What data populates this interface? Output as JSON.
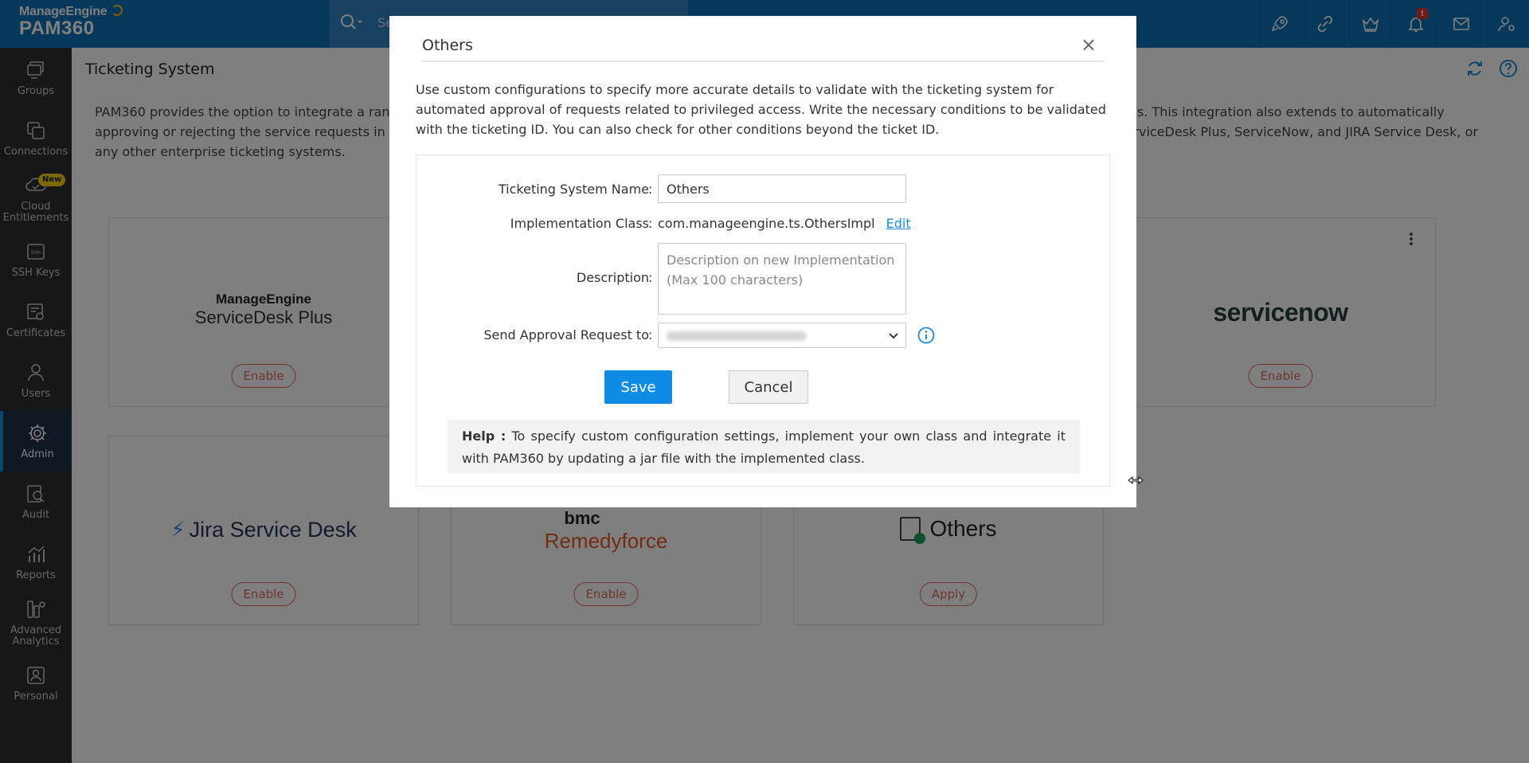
{
  "brand": {
    "company": "ManageEngine",
    "product": "PAM360"
  },
  "search": {
    "placeholder": "Se"
  },
  "notifications": {
    "badge": "!"
  },
  "sidebar": {
    "items": [
      {
        "label": "Groups"
      },
      {
        "label": "Connections"
      },
      {
        "label": "Cloud Entitlements",
        "badge": "New"
      },
      {
        "label": "SSH Keys"
      },
      {
        "label": "Certificates"
      },
      {
        "label": "Users"
      },
      {
        "label": "Admin"
      },
      {
        "label": "Audit"
      },
      {
        "label": "Reports"
      },
      {
        "label": "Advanced Analytics"
      },
      {
        "label": "Personal"
      }
    ]
  },
  "page": {
    "title": "Ticketing System",
    "intro": "PAM360 provides the option to integrate a range of ticketing systems to ensure that only the users with a valid ticket ID access the authorized privileged passwords. This integration also extends to automatically approving or rejecting the service requests in the ticketing system. From this page, you can select the ticketing system that you wish to integrate with, such as ServiceDesk Plus, ServiceNow, and JIRA Service Desk, or any other enterprise ticketing systems."
  },
  "cards": [
    {
      "name": "ManageEngine ServiceDesk Plus",
      "logo_top": "ManageEngine",
      "logo_bottom": "ServiceDesk Plus",
      "action": "Enable"
    },
    {
      "name": "ServiceNow",
      "logo": "servicenow",
      "action": "Enable"
    },
    {
      "name": "Jira Service Desk",
      "logo": "Jira Service Desk",
      "action": "Enable"
    },
    {
      "name": "BMC Remedyforce",
      "logo_top": "bmc",
      "logo_bottom": "Remedyforce",
      "action": "Enable"
    },
    {
      "name": "Others",
      "logo": "Others",
      "action": "Apply"
    }
  ],
  "modal": {
    "title": "Others",
    "close": "×",
    "description": "Use custom configurations to specify more accurate details to validate with the ticketing system for automated approval of requests related to privileged access. Write the necessary conditions to be validated with the ticketing ID. You can also check for other conditions beyond the ticket ID.",
    "fields": {
      "name_label": "Ticketing System Name",
      "name_value": "Others",
      "impl_label": "Implementation Class",
      "impl_value": "com.manageengine.ts.OthersImpl",
      "edit_label": "Edit",
      "desc_label": "Description",
      "desc_placeholder": "Description on new Implementation (Max 100 characters)",
      "approval_label": "Send Approval Request to",
      "colon": ":"
    },
    "save_label": "Save",
    "cancel_label": "Cancel",
    "help_title": "Help :",
    "help_text": "To specify custom configuration settings, implement your own class and integrate it with PAM360 by updating a jar file with the implemented class."
  },
  "colors": {
    "topbar": "#0a70b6",
    "sidebar": "#2d2f33",
    "primary_button": "#0e8be4",
    "enable_outline": "#e06a5c"
  }
}
